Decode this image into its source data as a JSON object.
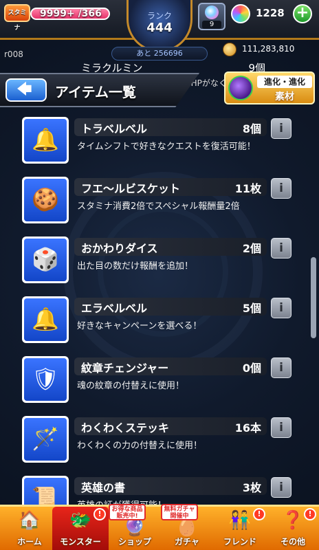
{
  "status": {
    "stamina_label": "スタミナ",
    "stamina_value": "9999+ /366",
    "rank_label": "ランク",
    "rank_value": "444",
    "next_exp": "あと 256696",
    "friend_count": "9",
    "orb_count": "1228",
    "plus_label": "+",
    "coins": "111,283,810",
    "debug_label": "r008"
  },
  "header": {
    "back_label": "🡄",
    "title": "アイテム一覧",
    "evolve_text1": "進化・進化",
    "evolve_text2": "素材",
    "behind_name": "ミラクルミン",
    "behind_count": "9個",
    "behind_desc": "クエストで…専用ステージで HPがなくなった時にHPのみ回"
  },
  "items": [
    {
      "name": "トラベルベル",
      "count": "8個",
      "desc": "タイムシフトで好きなクエストを復活可能！",
      "icon": "🔔"
    },
    {
      "name": "フエ〜ルビスケット",
      "count": "11枚",
      "desc": "スタミナ消費2倍でスペシャル報酬量2倍",
      "icon": "🍪"
    },
    {
      "name": "おかわりダイス",
      "count": "2個",
      "desc": "出た目の数だけ報酬を追加！",
      "icon": "🎲"
    },
    {
      "name": "エラベルベル",
      "count": "5個",
      "desc": "好きなキャンペーンを選べる！",
      "icon": "🔔"
    },
    {
      "name": "紋章チェンジャー",
      "count": "0個",
      "desc": "魂の紋章の付替えに使用！",
      "icon": "🛡"
    },
    {
      "name": "わくわくステッキ",
      "count": "16本",
      "desc": "わくわくの力の付替えに使用！",
      "icon": "🪄"
    },
    {
      "name": "英雄の書",
      "count": "3枚",
      "desc": "英雄の証が獲得可能！",
      "icon": "📜"
    }
  ],
  "info_label": "i",
  "nav": {
    "home": "ホーム",
    "monster": "モンスター",
    "shop": "ショップ",
    "gacha": "ガチャ",
    "friend": "フレンド",
    "other": "その他",
    "shop_badge": "お得な商品販売中!",
    "gacha_badge": "無料ガチャ開催中",
    "alert": "!"
  },
  "colors": {
    "nav_bg": "#ff9a1a",
    "item_icon_bg": "#2a5fe8",
    "accent_active": "#d8180e"
  }
}
